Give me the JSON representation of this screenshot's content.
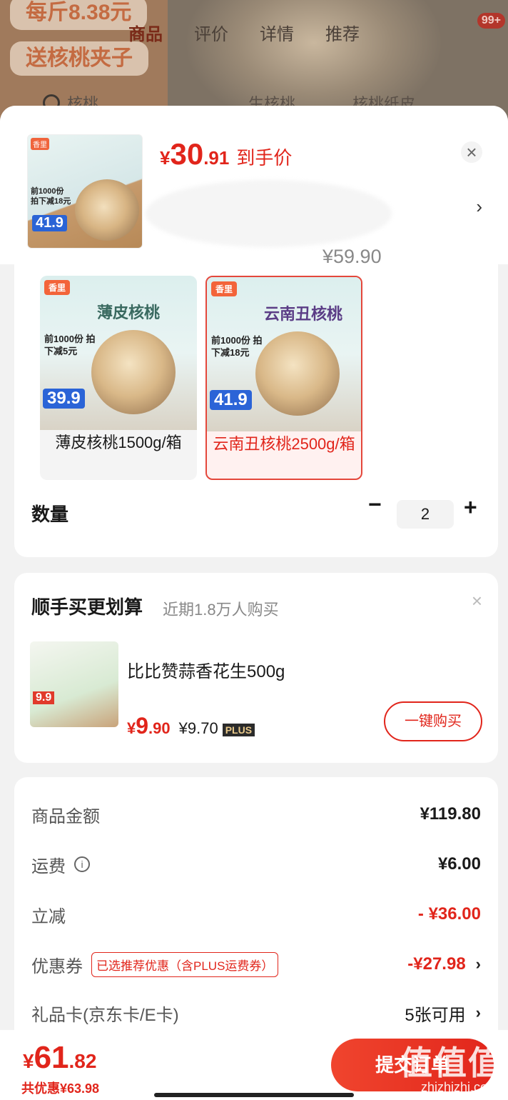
{
  "background": {
    "tags": [
      "每斤8.38元",
      "送核桃夹子"
    ],
    "tabs": [
      "商品",
      "评价",
      "详情",
      "推荐"
    ],
    "badge": "99+",
    "search_items": [
      "核桃",
      "生核桃",
      "核桃纸皮…"
    ]
  },
  "product": {
    "thumb_logo": "香里",
    "thumb_text": "前1000份 拍下减18元",
    "thumb_price": "41.9",
    "currency": "¥",
    "price_int": "30",
    "price_dec": ".91",
    "price_label": "到手价",
    "original_price": "¥59.90"
  },
  "specs": [
    {
      "brand": "香里",
      "title": "薄皮核桃",
      "promo": "前1000份 拍下减5元",
      "price": "39.9",
      "label": "薄皮核桃1500g/箱",
      "selected": false
    },
    {
      "brand": "香里",
      "title": "云南丑核桃",
      "promo": "前1000份 拍下减18元",
      "price": "41.9",
      "label": "云南丑核桃2500g/箱",
      "selected": true
    }
  ],
  "quantity": {
    "label": "数量",
    "minus": "−",
    "value": "2",
    "plus": "+"
  },
  "addon": {
    "title": "顺手买更划算",
    "subtitle": "近期1.8万人购买",
    "close": "×",
    "img_badge": "9.9",
    "name": "比比赞蒜香花生500g",
    "price_symbol": "¥",
    "price_int": "9",
    "price_dec": ".90",
    "plus_price": "¥9.70",
    "plus_tag": "PLUS",
    "buy_label": "一键购买"
  },
  "summary": {
    "goods_label": "商品金额",
    "goods_value": "¥119.80",
    "shipping_label": "运费",
    "shipping_info": "i",
    "shipping_value": "¥6.00",
    "discount_label": "立减",
    "discount_value": "- ¥36.00",
    "coupon_label": "优惠券",
    "coupon_tag": "已选推荐优惠（含PLUS运费券）",
    "coupon_value": "-¥27.98",
    "giftcard_label": "礼品卡(京东卡/E卡)",
    "giftcard_value": "5张可用",
    "chevron": "›"
  },
  "bottom": {
    "currency": "¥",
    "total_int": "61",
    "total_dec": ".82",
    "saved": "共优惠¥63.98",
    "submit": "提交订单"
  },
  "watermark": {
    "text": "值值值",
    "site": "zhizhizhi.com"
  },
  "colors": {
    "accent": "#e1251b",
    "plus_gold": "#e9c98a",
    "price_blue": "#2b64d7"
  }
}
